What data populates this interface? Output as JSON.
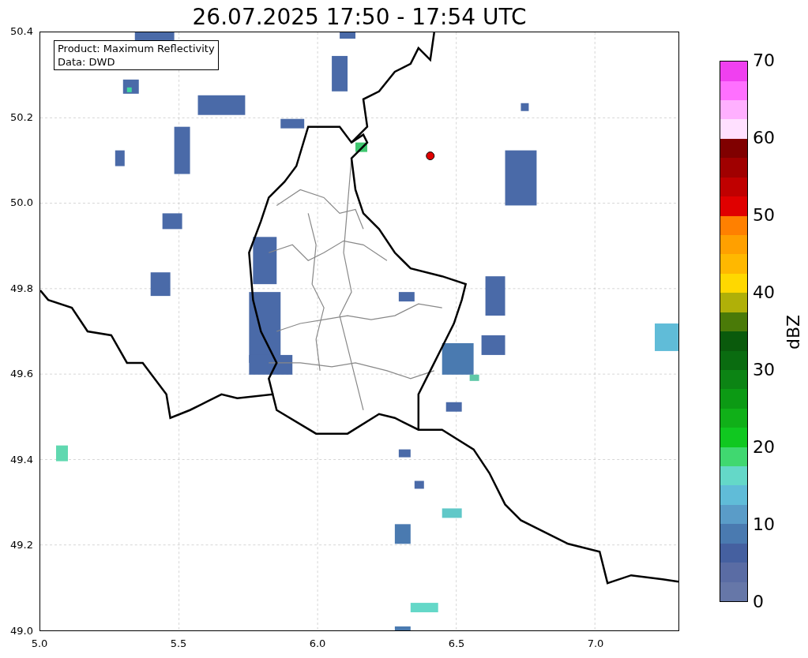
{
  "title": "26.07.2025 17:50 - 17:54 UTC",
  "info_box": [
    "Product: Maximum Reflectivity",
    "Data: DWD"
  ],
  "map": {
    "xticks": [
      "5.0",
      "5.5",
      "6.0",
      "6.5",
      "7.0"
    ],
    "yticks": [
      "50.4",
      "50.2",
      "50.0",
      "49.8",
      "49.6",
      "49.4",
      "49.2",
      "49.0"
    ]
  },
  "colorbar": {
    "label": "dBZ",
    "ticks": [
      "70",
      "60",
      "50",
      "40",
      "30",
      "20",
      "10",
      "0"
    ],
    "segments": [
      {
        "color": "#6677a8"
      },
      {
        "color": "#5a6ca4"
      },
      {
        "color": "#4560a0"
      },
      {
        "color": "#4a7ab0"
      },
      {
        "color": "#5a9cc8"
      },
      {
        "color": "#60bcd8"
      },
      {
        "color": "#64d8c8"
      },
      {
        "color": "#40d870"
      },
      {
        "color": "#10c820"
      },
      {
        "color": "#10b018"
      },
      {
        "color": "#0c9a14"
      },
      {
        "color": "#0c8414"
      },
      {
        "color": "#0a6c10"
      },
      {
        "color": "#0a5a0c"
      },
      {
        "color": "#4a7a08"
      },
      {
        "color": "#b0b008"
      },
      {
        "color": "#ffd800"
      },
      {
        "color": "#ffb800"
      },
      {
        "color": "#ffa000"
      },
      {
        "color": "#ff8000"
      },
      {
        "color": "#e00000"
      },
      {
        "color": "#c00000"
      },
      {
        "color": "#a00000"
      },
      {
        "color": "#800000"
      },
      {
        "color": "#ffe0ff"
      },
      {
        "color": "#ffb0ff"
      },
      {
        "color": "#ff70ff"
      },
      {
        "color": "#f040f0"
      }
    ]
  }
}
